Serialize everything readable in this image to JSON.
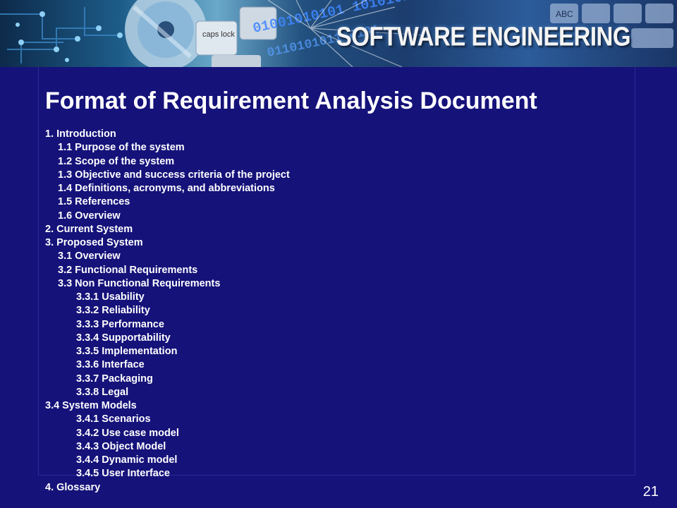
{
  "banner": {
    "title": "SOFTWARE ENGINEERING",
    "keyboard_key_text": "caps lock",
    "binary_text": "01001010101 10101010 01010",
    "key_abc_text": "ABC"
  },
  "slide": {
    "title": "Format of Requirement Analysis Document",
    "page_number": "21",
    "items": [
      {
        "text": "1. Introduction",
        "level": 0
      },
      {
        "text": "1.1 Purpose of the system",
        "level": 1
      },
      {
        "text": "1.2 Scope of the system",
        "level": 1
      },
      {
        "text": "1.3 Objective and success criteria of the project",
        "level": 1
      },
      {
        "text": "1.4 Definitions, acronyms, and abbreviations",
        "level": 1
      },
      {
        "text": "1.5 References",
        "level": 1
      },
      {
        "text": "1.6 Overview",
        "level": 1
      },
      {
        "text": "2. Current System",
        "level": 0
      },
      {
        "text": "3. Proposed System",
        "level": 0
      },
      {
        "text": "3.1 Overview",
        "level": 1
      },
      {
        "text": "3.2 Functional Requirements",
        "level": 1
      },
      {
        "text": "3.3 Non Functional Requirements",
        "level": 1
      },
      {
        "text": "3.3.1 Usability",
        "level": 2
      },
      {
        "text": "3.3.2 Reliability",
        "level": 2
      },
      {
        "text": "3.3.3 Performance",
        "level": 2
      },
      {
        "text": "3.3.4 Supportability",
        "level": 2
      },
      {
        "text": "3.3.5 Implementation",
        "level": 2
      },
      {
        "text": "3.3.6 Interface",
        "level": 2
      },
      {
        "text": "3.3.7 Packaging",
        "level": 2
      },
      {
        "text": "3.3.8 Legal",
        "level": 2
      },
      {
        "text": "3.4 System Models",
        "level": 0
      },
      {
        "text": "3.4.1 Scenarios",
        "level": 2
      },
      {
        "text": "3.4.2 Use case model",
        "level": 2
      },
      {
        "text": "3.4.3 Object Model",
        "level": 2
      },
      {
        "text": "3.4.4 Dynamic model",
        "level": 2
      },
      {
        "text": "3.4.5 User Interface",
        "level": 2
      },
      {
        "text": "4. Glossary",
        "level": 0
      }
    ]
  }
}
